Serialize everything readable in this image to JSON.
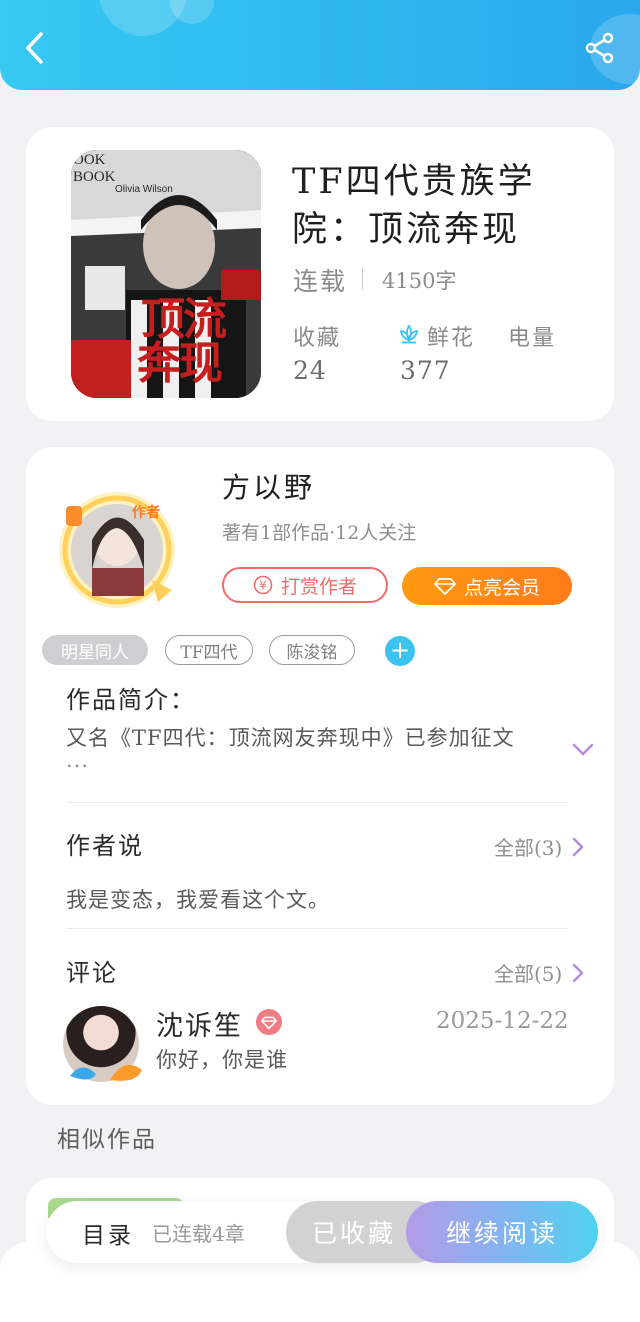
{
  "book": {
    "title": "TF四代贵族学院：顶流奔现",
    "status": "连载",
    "word_count": "4150字",
    "stats": [
      {
        "label": "收藏",
        "value": "24",
        "icon": ""
      },
      {
        "label": "鲜花",
        "value": "377",
        "icon": "lotus-icon"
      },
      {
        "label": "电量",
        "value": "",
        "icon": ""
      }
    ],
    "cover": {
      "big_text_1": "顶流",
      "big_text_2": "奔现",
      "corner_text": "OOK BOOK",
      "byline": "Olivia Wilson"
    }
  },
  "author": {
    "name": "方以野",
    "meta": "著有1部作品·12人关注",
    "badge": "作者",
    "tip_label": "打赏作者",
    "vip_label": "点亮会员"
  },
  "tags": [
    "明星同人",
    "TF四代",
    "陈浚铭"
  ],
  "intro": {
    "title": "作品简介：",
    "text": "又名《TF四代：顶流网友奔现中》已参加征文",
    "ellipsis": "..."
  },
  "author_says": {
    "title": "作者说",
    "more": "全部(3)",
    "text": "我是变态，我爱看这个文。"
  },
  "comments": {
    "title": "评论",
    "more": "全部(5)",
    "items": [
      {
        "name": "沈诉笙",
        "date": "2025-12-22",
        "text": "你好，你是谁"
      }
    ]
  },
  "similar": {
    "title": "相似作品"
  },
  "bottom": {
    "toc": "目录",
    "chapters": "已连载4章",
    "favorited": "已收藏",
    "continue": "继续阅读"
  },
  "colors": {
    "header": "#2fb7ee",
    "accent_blue": "#3cc3f0",
    "tip_red": "#f06c6c",
    "vip_orange": "#ff8a14",
    "chevron_purple": "#b48be0"
  }
}
